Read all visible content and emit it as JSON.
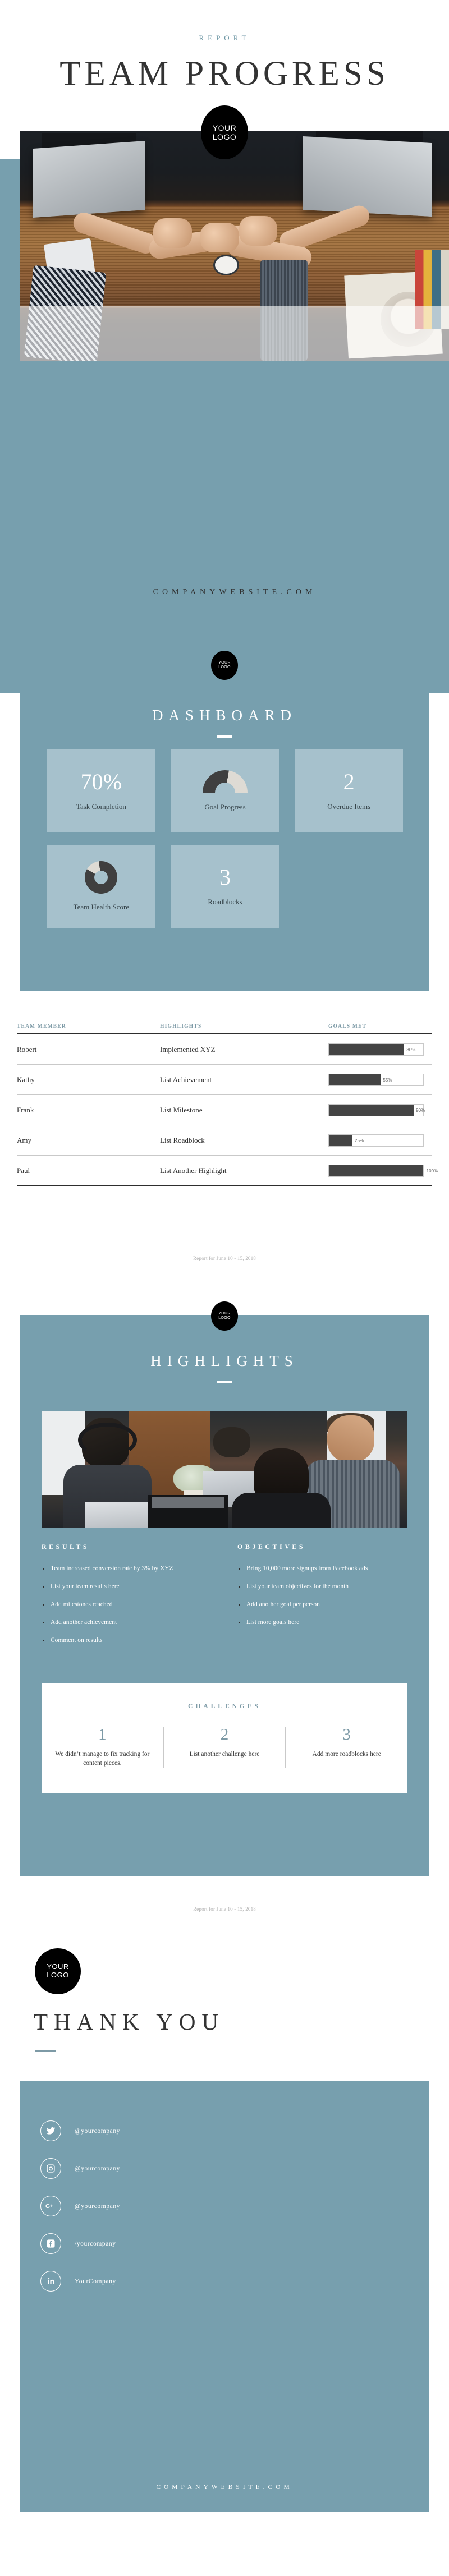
{
  "cover": {
    "eyebrow": "REPORT",
    "title": "TEAM PROGRESS",
    "logo_line1": "YOUR",
    "logo_line2": "LOGO",
    "website": "COMPANYWEBSITE.COM"
  },
  "dashboard": {
    "title": "DASHBOARD",
    "logo_line1": "YOUR",
    "logo_line2": "LOGO",
    "cards": [
      {
        "value": "70%",
        "label": "Task Completion",
        "type": "number"
      },
      {
        "value": "",
        "label": "Goal Progress",
        "type": "gauge",
        "percent": 55
      },
      {
        "value": "2",
        "label": "Overdue Items",
        "type": "number"
      },
      {
        "value": "",
        "label": "Team Health Score",
        "type": "donut",
        "percent": 85
      },
      {
        "value": "3",
        "label": "Roadblocks",
        "type": "number"
      }
    ]
  },
  "table": {
    "headers": [
      "TEAM MEMBER",
      "HIGHLIGHTS",
      "GOALS MET"
    ],
    "rows": [
      {
        "member": "Robert",
        "highlight": "Implemented XYZ",
        "percent": 80,
        "percent_label": "80%"
      },
      {
        "member": "Kathy",
        "highlight": "List Achievement",
        "percent": 55,
        "percent_label": "55%"
      },
      {
        "member": "Frank",
        "highlight": "List Milestone",
        "percent": 90,
        "percent_label": "90%"
      },
      {
        "member": "Amy",
        "highlight": "List Roadblock",
        "percent": 25,
        "percent_label": "25%"
      },
      {
        "member": "Paul",
        "highlight": "List Another Highlight",
        "percent": 100,
        "percent_label": "100%"
      }
    ]
  },
  "report_date": "Report for June 10 - 15, 2018",
  "highlights": {
    "title": "HIGHLIGHTS",
    "logo_line1": "YOUR",
    "logo_line2": "LOGO",
    "results_title": "RESULTS",
    "results": [
      "Team increased conversion rate by 3% by XYZ",
      "List your team results here",
      "Add milestones reached",
      "Add another achievement",
      "Comment on results"
    ],
    "objectives_title": "OBJECTIVES",
    "objectives": [
      "Bring 10,000 more signups from Facebook ads",
      "List your team objectives for the month",
      "Add another goal per person",
      "List more goals here"
    ],
    "challenges_title": "CHALLENGES",
    "challenges": [
      {
        "num": "1",
        "text": "We didn’t manage to fix tracking for content pieces."
      },
      {
        "num": "2",
        "text": "List another challenge here"
      },
      {
        "num": "3",
        "text": "Add more roadblocks here"
      }
    ]
  },
  "thanks": {
    "title": "THANK YOU",
    "logo_line1": "YOUR",
    "logo_line2": "LOGO",
    "social": [
      {
        "icon": "twitter-icon",
        "handle": "@yourcompany"
      },
      {
        "icon": "instagram-icon",
        "handle": "@yourcompany"
      },
      {
        "icon": "google-plus-icon",
        "handle": "@yourcompany"
      },
      {
        "icon": "facebook-icon",
        "handle": "/yourcompany"
      },
      {
        "icon": "linkedin-icon",
        "handle": "YourCompany"
      }
    ],
    "footer_url": "COMPANYWEBSITE.COM"
  },
  "colors": {
    "teal": "#779fae",
    "card": "#a6c1cc",
    "dark": "#3f3f3f",
    "light_gray": "#dedbd4",
    "text": "#333333"
  }
}
